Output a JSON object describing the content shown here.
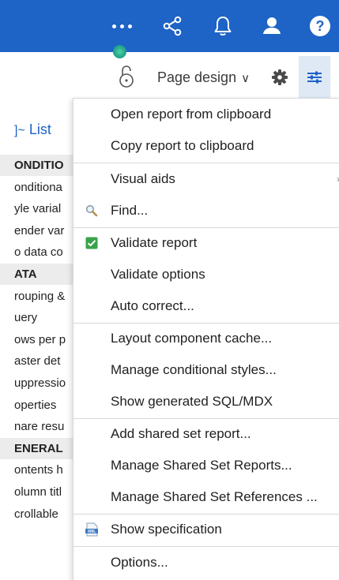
{
  "topbar": {
    "icons": [
      "more-icon",
      "share-icon",
      "notification-bell-icon",
      "user-icon",
      "help-icon"
    ],
    "help_glyph": "?"
  },
  "toolbar": {
    "page_design_label": "Page design",
    "page_design_chevron": "∨"
  },
  "left_panel": {
    "list_label": "List",
    "list_icon_glyph": "]~",
    "rows": [
      {
        "text": "ONDITIO",
        "section": true
      },
      {
        "text": "onditiona",
        "section": false
      },
      {
        "text": "yle varial",
        "section": false
      },
      {
        "text": "ender var",
        "section": false
      },
      {
        "text": "o data co",
        "section": false
      },
      {
        "text": "ATA",
        "section": true
      },
      {
        "text": "rouping &",
        "section": false
      },
      {
        "text": "uery",
        "section": false
      },
      {
        "text": "ows per p",
        "section": false
      },
      {
        "text": "aster det",
        "section": false
      },
      {
        "text": "uppressio",
        "section": false
      },
      {
        "text": "operties",
        "section": false
      },
      {
        "text": "nare resu",
        "section": false
      },
      {
        "text": "ENERAL",
        "section": true
      },
      {
        "text": "ontents h",
        "section": false
      },
      {
        "text": "olumn titl",
        "section": false
      },
      {
        "text": "crollable",
        "section": false
      }
    ]
  },
  "menu": {
    "items": [
      {
        "label": "Open report from clipboard"
      },
      {
        "label": "Copy report to clipboard"
      },
      {
        "label": "Visual aids",
        "submenu": true
      },
      {
        "label": "Find...",
        "icon": "search-icon"
      },
      {
        "label": "Validate report",
        "icon": "validate-check-icon"
      },
      {
        "label": "Validate options"
      },
      {
        "label": "Auto correct..."
      },
      {
        "label": "Layout component cache..."
      },
      {
        "label": "Manage conditional styles..."
      },
      {
        "label": "Show generated SQL/MDX"
      },
      {
        "label": "Add shared set report..."
      },
      {
        "label": "Manage Shared Set Reports..."
      },
      {
        "label": "Manage Shared Set References ..."
      },
      {
        "label": "Show specification",
        "icon": "xml-file-icon"
      },
      {
        "label": "Options..."
      }
    ],
    "xml_badge": "XML"
  },
  "colors": {
    "topbar": "#1e63c6",
    "accent": "#1e63c6",
    "validate_green": "#3aa34a",
    "presence_dot": "#35b08f"
  }
}
